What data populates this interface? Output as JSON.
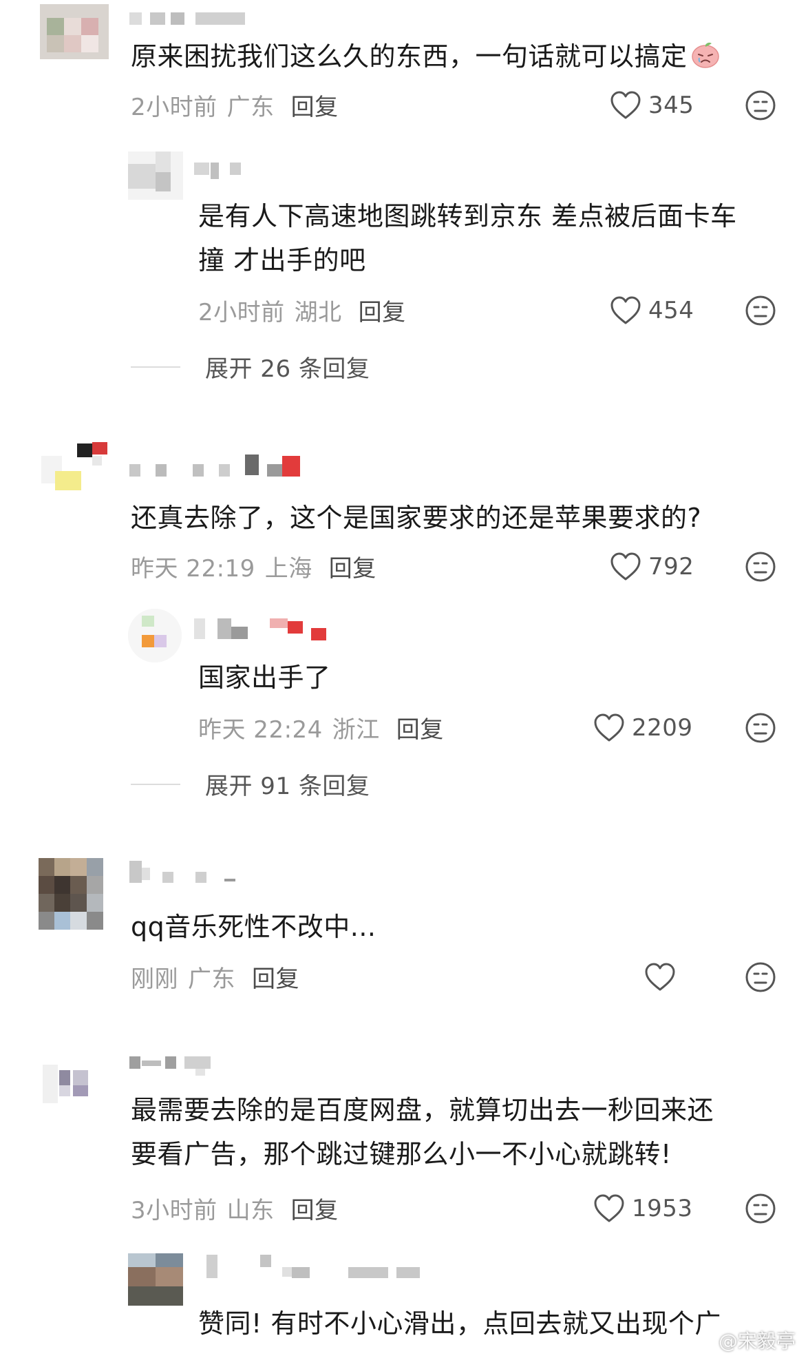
{
  "comments": [
    {
      "text": "原来困扰我们这么久的东西，一句话就可以搞定",
      "time": "2小时前",
      "region": "广东",
      "reply": "回复",
      "likes": "345",
      "replies": [
        {
          "text_lines": [
            "是有人下高速地图跳转到京东 差点被后面卡车",
            "撞 才出手的吧"
          ],
          "time": "2小时前",
          "region": "湖北",
          "reply": "回复",
          "likes": "454"
        }
      ],
      "expand": "展开 26 条回复"
    },
    {
      "text": "还真去除了，这个是国家要求的还是苹果要求的?",
      "time": "昨天 22:19",
      "region": "上海",
      "reply": "回复",
      "likes": "792",
      "replies": [
        {
          "text_lines": [
            "国家出手了"
          ],
          "time": "昨天 22:24",
          "region": "浙江",
          "reply": "回复",
          "likes": "2209"
        }
      ],
      "expand": "展开 91 条回复"
    },
    {
      "text": "qq音乐死性不改中...",
      "time": "刚刚",
      "region": "广东",
      "reply": "回复",
      "likes": ""
    },
    {
      "text_lines": [
        "最需要去除的是百度网盘，就算切出去一秒回来还",
        "要看广告，那个跳过键那么小一不小心就跳转!"
      ],
      "time": "3小时前",
      "region": "山东",
      "reply": "回复",
      "likes": "1953",
      "replies": [
        {
          "text_lines": [
            "赞同! 有时不小心滑出，点回去就又出现个广"
          ]
        }
      ]
    }
  ],
  "icons": {
    "like": "heart-outline-icon",
    "dislike": "unhappy-face-icon",
    "emoji": "sad-peach-emoji-icon",
    "watermark_logo": "weibo-logo-icon"
  },
  "watermark": "@宋毅亭",
  "colors": {
    "text": "#1a1a1a",
    "meta": "#9a9a9a",
    "reply": "#4b4b4b",
    "icon": "#555555"
  }
}
